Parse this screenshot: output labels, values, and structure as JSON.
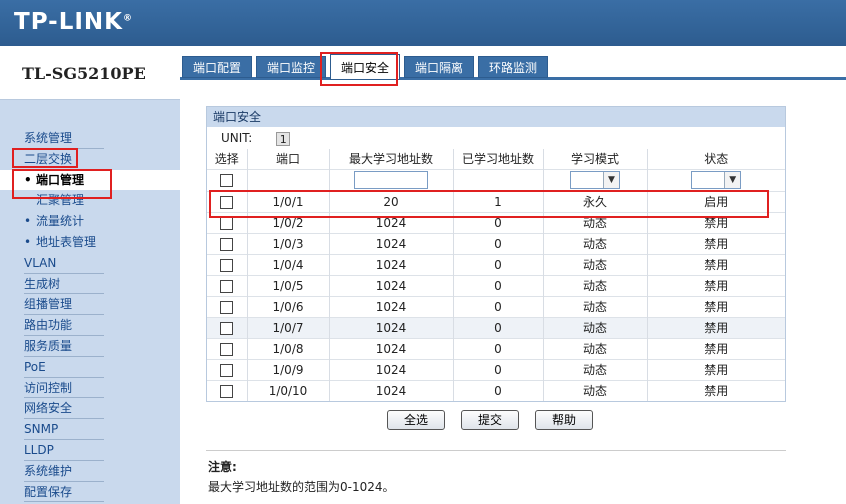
{
  "header": {
    "logo": "TP-LINK",
    "logo_mark": "®"
  },
  "sidebar": {
    "model": "TL-SG5210PE",
    "items": [
      {
        "label": "系统管理",
        "sub": false,
        "active": false
      },
      {
        "label": "二层交换",
        "sub": false,
        "active": false
      },
      {
        "label": "端口管理",
        "sub": true,
        "active": true,
        "bullet": true
      },
      {
        "label": "汇聚管理",
        "sub": true,
        "active": false,
        "bullet": false
      },
      {
        "label": "流量统计",
        "sub": true,
        "active": false,
        "bullet": true
      },
      {
        "label": "地址表管理",
        "sub": true,
        "active": false,
        "bullet": true
      },
      {
        "label": "VLAN",
        "sub": false,
        "active": false
      },
      {
        "label": "生成树",
        "sub": false,
        "active": false
      },
      {
        "label": "组播管理",
        "sub": false,
        "active": false
      },
      {
        "label": "路由功能",
        "sub": false,
        "active": false
      },
      {
        "label": "服务质量",
        "sub": false,
        "active": false
      },
      {
        "label": "PoE",
        "sub": false,
        "active": false
      },
      {
        "label": "访问控制",
        "sub": false,
        "active": false
      },
      {
        "label": "网络安全",
        "sub": false,
        "active": false
      },
      {
        "label": "SNMP",
        "sub": false,
        "active": false
      },
      {
        "label": "LLDP",
        "sub": false,
        "active": false
      },
      {
        "label": "系统维护",
        "sub": false,
        "active": false
      },
      {
        "label": "配置保存",
        "sub": false,
        "active": false
      }
    ]
  },
  "tabs": [
    {
      "label": "端口配置",
      "active": false
    },
    {
      "label": "端口监控",
      "active": false
    },
    {
      "label": "端口安全",
      "active": true
    },
    {
      "label": "端口隔离",
      "active": false
    },
    {
      "label": "环路监测",
      "active": false
    }
  ],
  "panel": {
    "title": "端口安全",
    "unit_label": "UNIT:",
    "unit_value": "1",
    "columns": [
      "选择",
      "端口",
      "最大学习地址数",
      "已学习地址数",
      "学习模式",
      "状态"
    ],
    "rows": [
      {
        "port": "1/0/1",
        "max": "20",
        "learned": "1",
        "mode": "永久",
        "status": "启用"
      },
      {
        "port": "1/0/2",
        "max": "1024",
        "learned": "0",
        "mode": "动态",
        "status": "禁用"
      },
      {
        "port": "1/0/3",
        "max": "1024",
        "learned": "0",
        "mode": "动态",
        "status": "禁用"
      },
      {
        "port": "1/0/4",
        "max": "1024",
        "learned": "0",
        "mode": "动态",
        "status": "禁用"
      },
      {
        "port": "1/0/5",
        "max": "1024",
        "learned": "0",
        "mode": "动态",
        "status": "禁用"
      },
      {
        "port": "1/0/6",
        "max": "1024",
        "learned": "0",
        "mode": "动态",
        "status": "禁用"
      },
      {
        "port": "1/0/7",
        "max": "1024",
        "learned": "0",
        "mode": "动态",
        "status": "禁用"
      },
      {
        "port": "1/0/8",
        "max": "1024",
        "learned": "0",
        "mode": "动态",
        "status": "禁用"
      },
      {
        "port": "1/0/9",
        "max": "1024",
        "learned": "0",
        "mode": "动态",
        "status": "禁用"
      },
      {
        "port": "1/0/10",
        "max": "1024",
        "learned": "0",
        "mode": "动态",
        "status": "禁用"
      }
    ]
  },
  "buttons": {
    "select_all": "全选",
    "submit": "提交",
    "help": "帮助"
  },
  "note": {
    "title": "注意:",
    "text": "最大学习地址数的范围为0-1024。"
  },
  "colors": {
    "header": "#3a6ea5",
    "sidebar": "#c9d9ed",
    "highlight": "#e02020"
  }
}
